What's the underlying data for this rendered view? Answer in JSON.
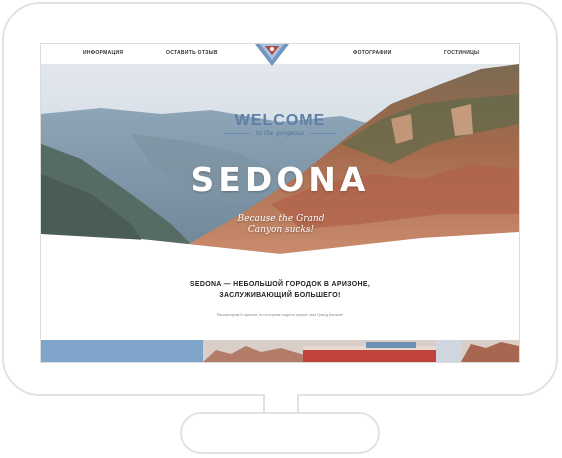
{
  "nav": {
    "items": [
      {
        "label": "ИНФОРМАЦИЯ"
      },
      {
        "label": "ОСТАВИТЬ ОТЗЫВ"
      },
      {
        "label": "ФОТОГРАФИИ"
      },
      {
        "label": "ГОСТИНИЦЫ"
      }
    ]
  },
  "hero": {
    "welcome": "WELCOME",
    "tagline": "to the gorgeous",
    "title": "SEDONA",
    "script_line1": "Because the Grand",
    "script_line2": "Canyon sucks!"
  },
  "intro": {
    "title_line1": "SEDONA — НЕБОЛЬШОЙ ГОРОДОК В АРИЗОНЕ,",
    "title_line2": "ЗАСЛУЖИВАЮЩИЙ БОЛЬШЕГО!",
    "text": "Рассмотрим 5 причин, по которым седона лучше чем Гранд Каньон!"
  },
  "colors": {
    "accent_blue": "#5f7fa8",
    "sky": "#c9d6e3",
    "rock": "#b5714f",
    "logo_red": "#b8453b"
  },
  "icons": {
    "logo": "sedona-logo-icon"
  }
}
